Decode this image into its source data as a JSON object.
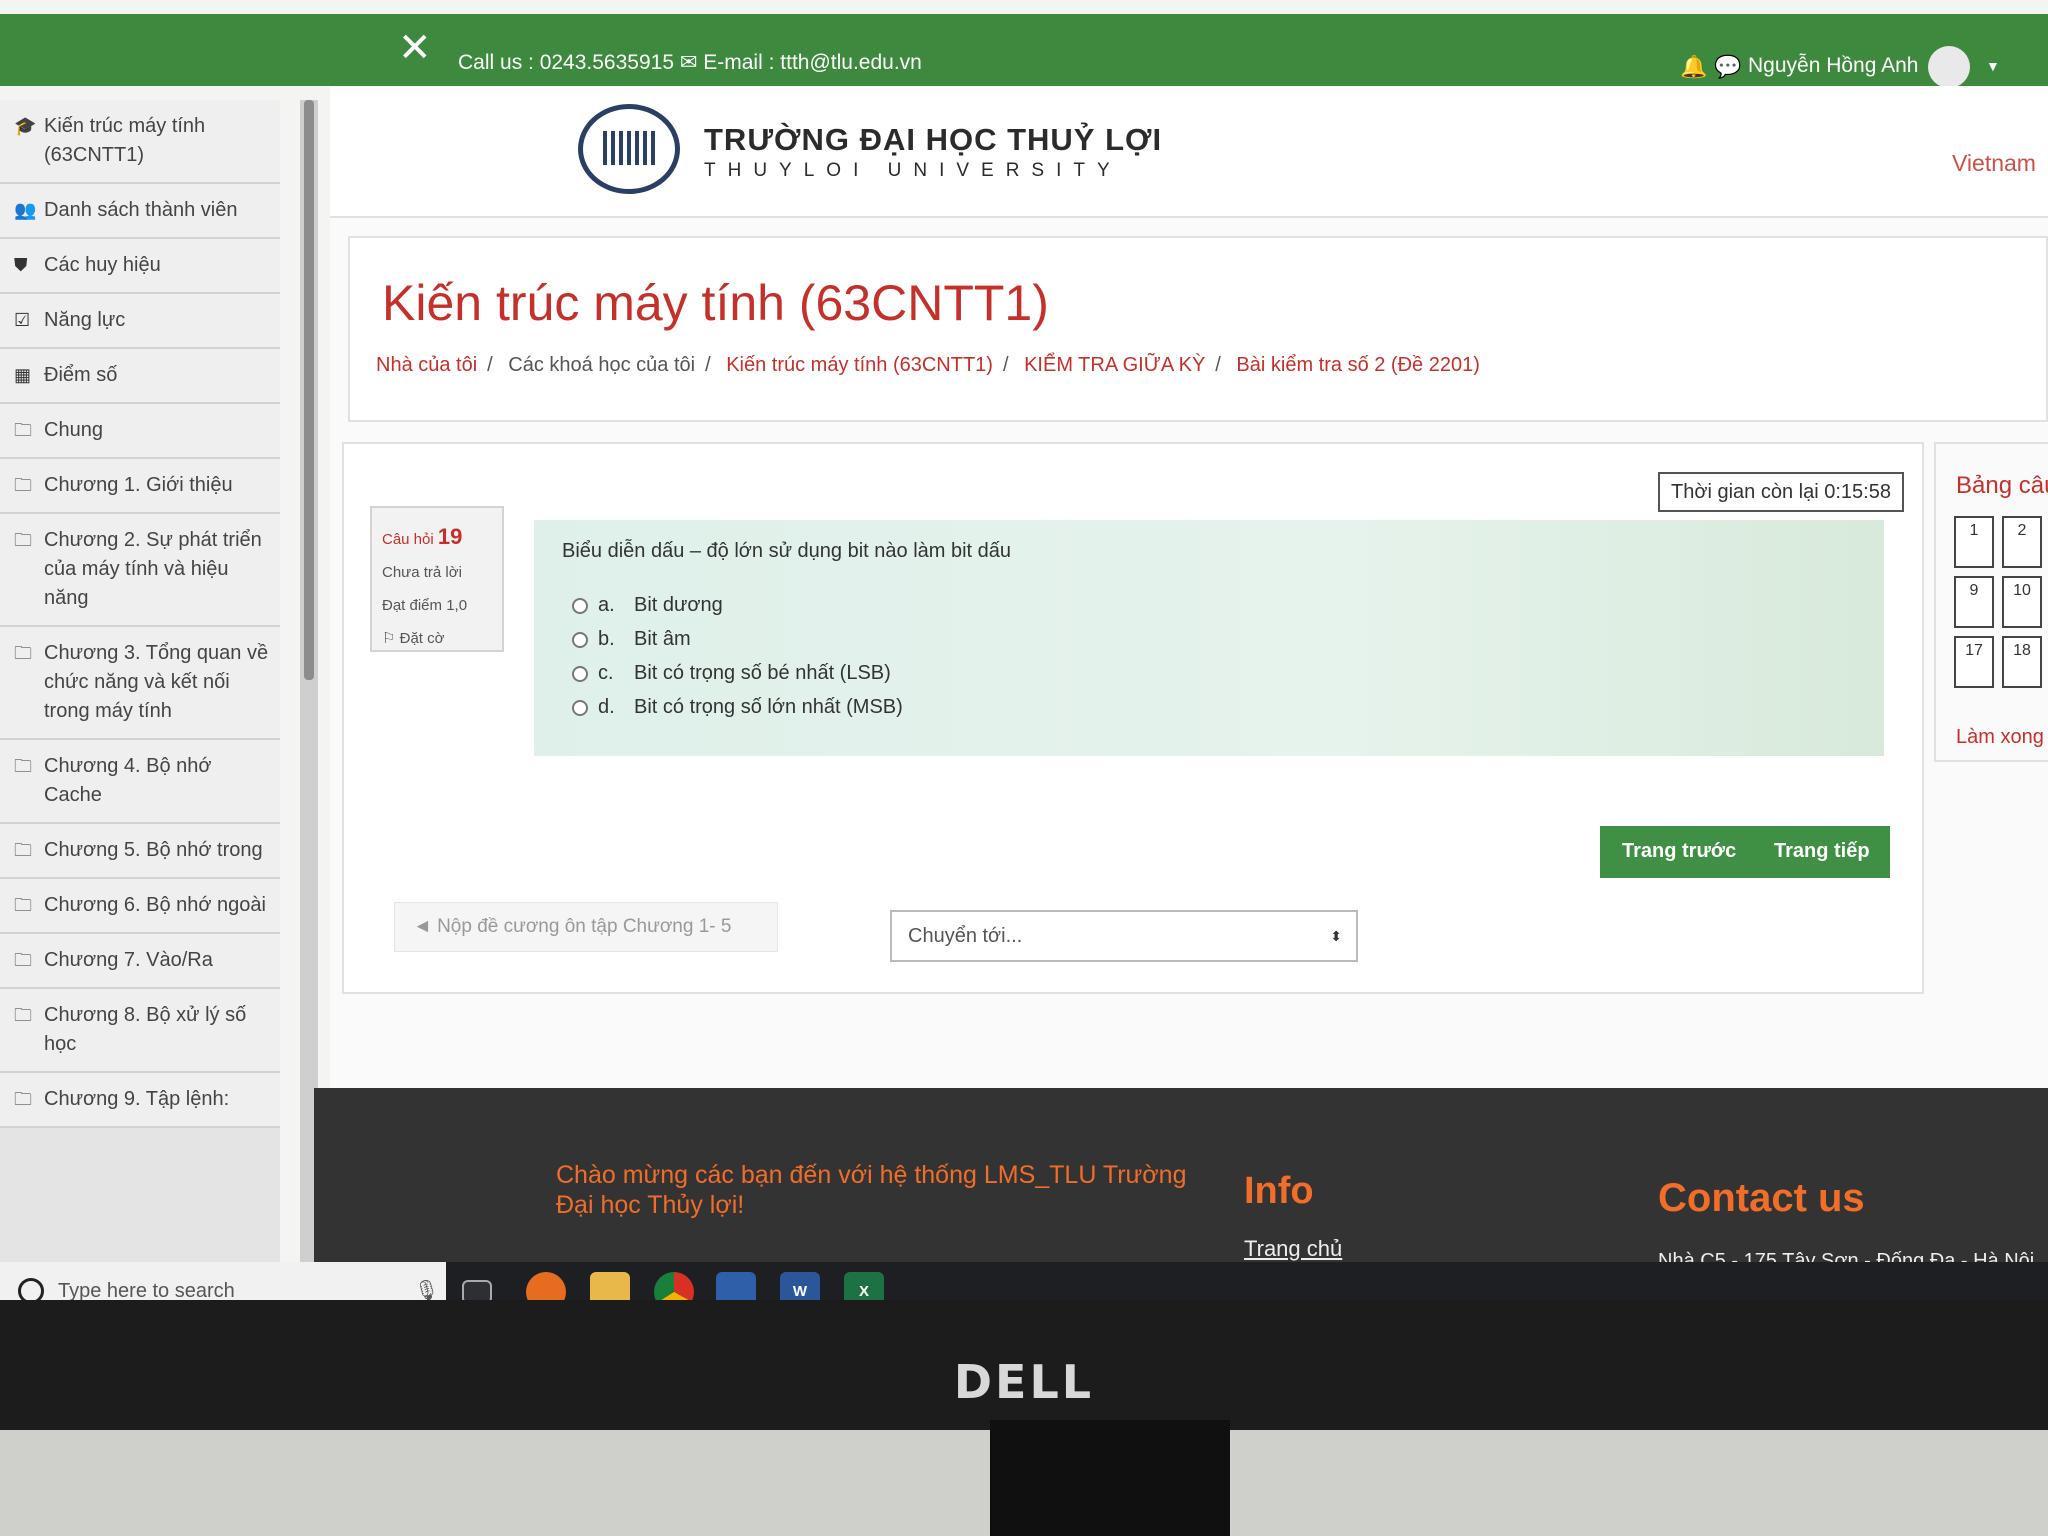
{
  "topbar": {
    "contact": "Call us : 0243.5635915 ✉ E-mail : ttth@tlu.edu.vn",
    "user_name": "Nguyễn Hồng Anh"
  },
  "sidebar": {
    "items": [
      {
        "icon": "graduation-cap-icon",
        "glyph": "🎓",
        "label": "Kiến trúc máy tính (63CNTT1)"
      },
      {
        "icon": "users-icon",
        "glyph": "👥",
        "label": "Danh sách thành viên"
      },
      {
        "icon": "shield-icon",
        "glyph": "⛊",
        "label": "Các huy hiệu"
      },
      {
        "icon": "check-square-icon",
        "glyph": "☑",
        "label": "Năng lực"
      },
      {
        "icon": "table-icon",
        "glyph": "▦",
        "label": "Điểm số"
      },
      {
        "icon": "folder-icon",
        "glyph": "🗀",
        "label": "Chung"
      },
      {
        "icon": "folder-icon",
        "glyph": "🗀",
        "label": "Chương 1. Giới thiệu"
      },
      {
        "icon": "folder-icon",
        "glyph": "🗀",
        "label": "Chương 2. Sự phát triển của máy tính và hiệu năng"
      },
      {
        "icon": "folder-icon",
        "glyph": "🗀",
        "label": "Chương 3. Tổng quan về chức năng và kết nối trong máy tính"
      },
      {
        "icon": "folder-icon",
        "glyph": "🗀",
        "label": "Chương 4. Bộ nhớ Cache"
      },
      {
        "icon": "folder-icon",
        "glyph": "🗀",
        "label": "Chương 5. Bộ nhớ trong"
      },
      {
        "icon": "folder-icon",
        "glyph": "🗀",
        "label": "Chương 6. Bộ nhớ ngoài"
      },
      {
        "icon": "folder-icon",
        "glyph": "🗀",
        "label": "Chương 7. Vào/Ra"
      },
      {
        "icon": "folder-icon",
        "glyph": "🗀",
        "label": "Chương 8. Bộ xử lý số học"
      },
      {
        "icon": "folder-icon",
        "glyph": "🗀",
        "label": "Chương 9. Tập lệnh:"
      }
    ]
  },
  "header": {
    "university_name": "TRƯỜNG ĐẠI HỌC THUỶ LỢI",
    "university_sub": "THUYLOI UNIVERSITY",
    "language": "Vietnam"
  },
  "course": {
    "title": "Kiến trúc máy tính (63CNTT1)",
    "breadcrumb": [
      "Nhà của tôi",
      "Các khoá học của tôi",
      "Kiến trúc máy tính (63CNTT1)",
      "KIỂM TRA GIỮA KỲ",
      "Bài kiểm tra số 2 (Đề 2201)"
    ]
  },
  "quiz": {
    "timer": "Thời gian còn lại 0:15:58",
    "question_label": "Câu hỏi",
    "question_number": "19",
    "status": "Chưa trả lời",
    "points": "Đạt điểm 1,0",
    "flag": "Đặt cờ",
    "question_text": "Biểu diễn dấu – độ lớn sử dụng bit nào làm bit dấu",
    "options": [
      {
        "letter": "a.",
        "text": "Bit dương"
      },
      {
        "letter": "b.",
        "text": "Bit âm"
      },
      {
        "letter": "c.",
        "text": "Bit có trọng số bé nhất (LSB)"
      },
      {
        "letter": "d.",
        "text": "Bit có trọng số lớn nhất (MSB)"
      }
    ],
    "prev_button": "Trang trước",
    "next_button": "Trang tiếp",
    "prev_activity": "◄ Nộp đề cương ôn tập Chương 1- 5",
    "jump_placeholder": "Chuyển tới..."
  },
  "navigation": {
    "title": "Bảng câu hỏi",
    "boxes": [
      "1",
      "2",
      "9",
      "10",
      "17",
      "18"
    ],
    "finish": "Làm xong"
  },
  "footer": {
    "welcome": "Chào mừng các bạn đến với hệ thống LMS_TLU Trường Đại học Thủy lợi!",
    "info_heading": "Info",
    "info_link": "Trang chủ",
    "contact_heading": "Contact us",
    "address": "Nhà C5 - 175 Tây Sơn - Đống Đa - Hà Nội"
  },
  "taskbar": {
    "search_placeholder": "Type here to search"
  },
  "monitor": {
    "brand": "DELL"
  },
  "colors": {
    "topbar": "#3d8a3f",
    "accent_red": "#c6302b",
    "footer_orange": "#f06d2a",
    "button_green": "#3f8f44"
  }
}
